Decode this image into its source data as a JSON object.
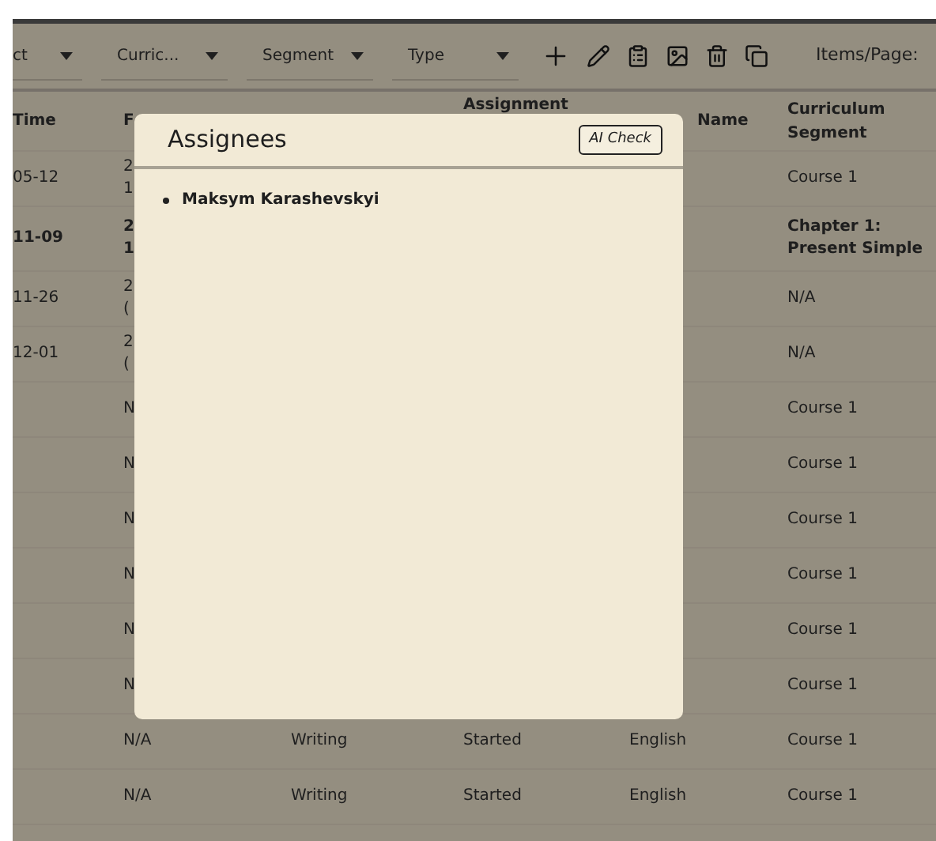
{
  "toolbar": {
    "filters": [
      {
        "label": "ct"
      },
      {
        "label": "Curric..."
      },
      {
        "label": "Segment"
      },
      {
        "label": "Type"
      }
    ],
    "items_per_page": "Items/Page:"
  },
  "table": {
    "columns": [
      {
        "label": "Time"
      },
      {
        "label": "F"
      },
      {},
      {
        "label": "Assignment"
      },
      {
        "label": "Name"
      },
      {
        "label": "Curriculum Segment"
      }
    ],
    "rows": [
      {
        "bold": false,
        "cells": [
          "05-12",
          "2\n1",
          null,
          null,
          null,
          "Course 1"
        ]
      },
      {
        "bold": true,
        "cells": [
          "11-09",
          "2\n1",
          null,
          null,
          null,
          "Chapter 1: Present Simple"
        ]
      },
      {
        "bold": false,
        "cells": [
          "11-26",
          "2\n(",
          null,
          null,
          null,
          "N/A"
        ]
      },
      {
        "bold": false,
        "cells": [
          "12-01",
          "2\n(",
          null,
          null,
          null,
          "N/A"
        ]
      },
      {
        "bold": false,
        "cells": [
          null,
          "N",
          null,
          null,
          null,
          "Course 1"
        ]
      },
      {
        "bold": false,
        "cells": [
          null,
          "N",
          null,
          null,
          null,
          "Course 1"
        ]
      },
      {
        "bold": false,
        "cells": [
          null,
          "N",
          null,
          null,
          null,
          "Course 1"
        ]
      },
      {
        "bold": false,
        "cells": [
          null,
          "N",
          null,
          null,
          null,
          "Course 1"
        ]
      },
      {
        "bold": false,
        "cells": [
          null,
          "N",
          null,
          null,
          null,
          "Course 1"
        ]
      },
      {
        "bold": false,
        "cells": [
          null,
          "N",
          null,
          null,
          null,
          "Course 1"
        ]
      },
      {
        "bold": false,
        "cells": [
          null,
          "N/A",
          "Writing",
          "Started",
          "English",
          "Course 1"
        ]
      },
      {
        "bold": false,
        "cells": [
          null,
          "N/A",
          "Writing",
          "Started",
          "English",
          "Course 1"
        ]
      }
    ]
  },
  "modal": {
    "title": "Assignees",
    "button": "AI Check",
    "assignees": [
      "Maksym Karashevskyi"
    ]
  }
}
